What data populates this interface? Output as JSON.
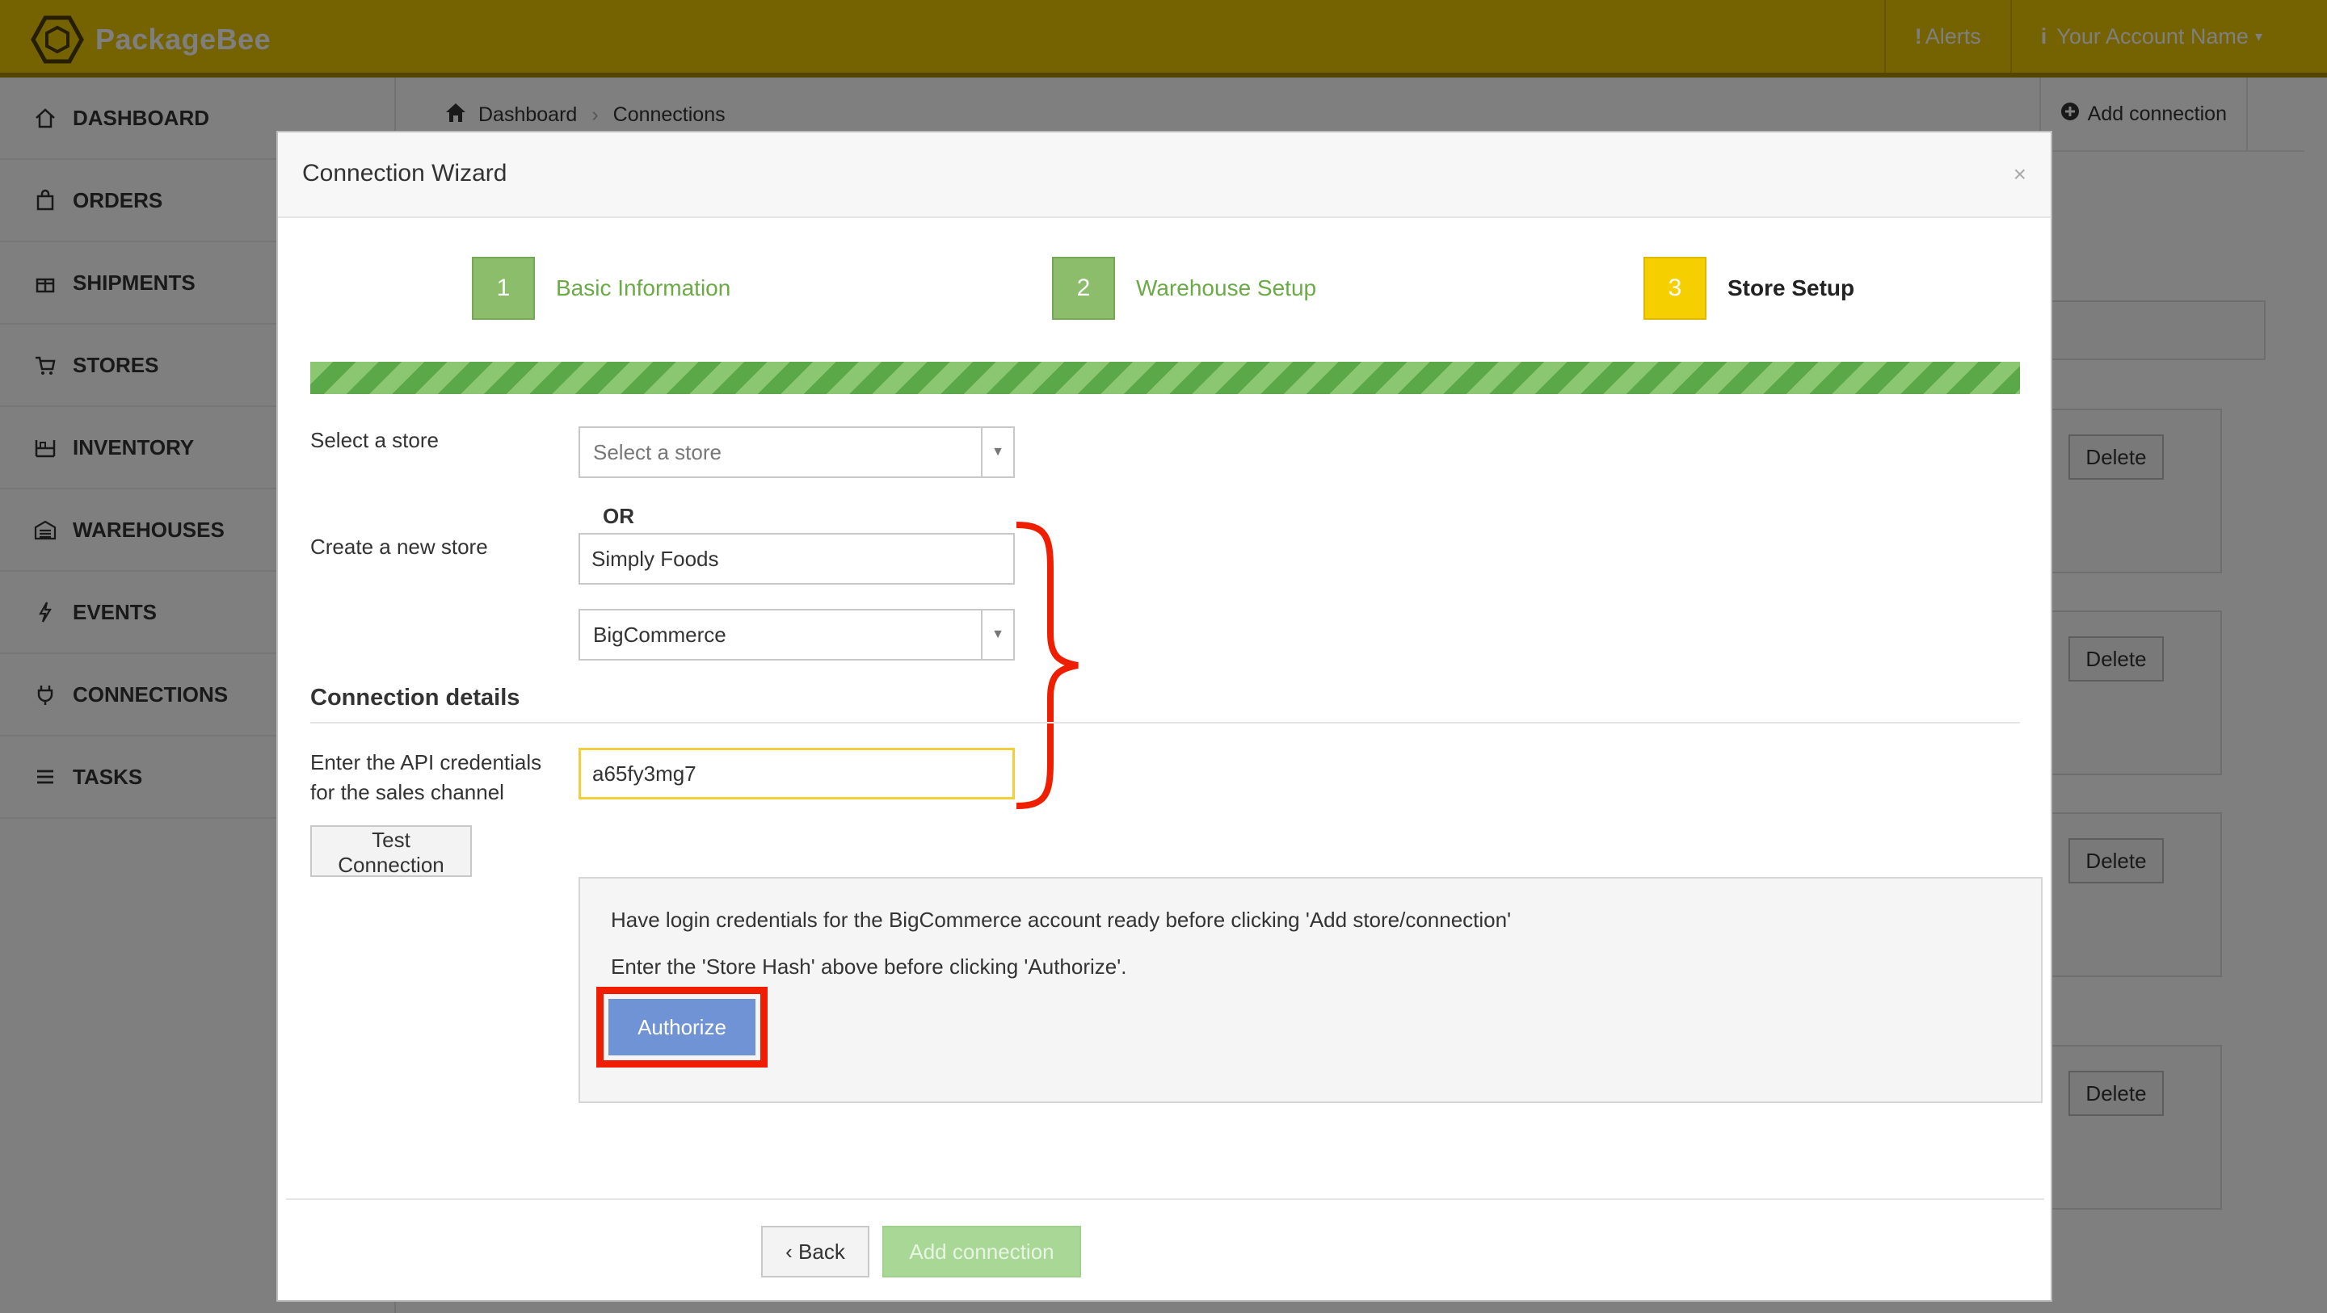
{
  "app": {
    "name": "PackageBee"
  },
  "topbar": {
    "alerts": "Alerts",
    "account": "Your Account Name"
  },
  "sidebar": {
    "items": [
      {
        "label": "DASHBOARD",
        "icon": "home-icon"
      },
      {
        "label": "ORDERS",
        "icon": "bag-icon"
      },
      {
        "label": "SHIPMENTS",
        "icon": "gift-icon"
      },
      {
        "label": "STORES",
        "icon": "cart-icon"
      },
      {
        "label": "INVENTORY",
        "icon": "inventory-icon"
      },
      {
        "label": "WAREHOUSES",
        "icon": "warehouse-icon"
      },
      {
        "label": "EVENTS",
        "icon": "bolt-icon"
      },
      {
        "label": "CONNECTIONS",
        "icon": "plug-icon"
      },
      {
        "label": "TASKS",
        "icon": "list-icon"
      }
    ]
  },
  "breadcrumb": {
    "home": "Dashboard",
    "current": "Connections",
    "add_connection": "Add connection"
  },
  "background": {
    "delete_label": "Delete"
  },
  "modal": {
    "title": "Connection Wizard",
    "close": "×",
    "steps": [
      {
        "number": "1",
        "label": "Basic Information",
        "state": "done"
      },
      {
        "number": "2",
        "label": "Warehouse Setup",
        "state": "done"
      },
      {
        "number": "3",
        "label": "Store Setup",
        "state": "active"
      }
    ],
    "select_store_label": "Select a store",
    "select_store_placeholder": "Select a store",
    "or_text": "OR",
    "create_store_label": "Create a new store",
    "new_store_name": "Simply Foods",
    "platform": "BigCommerce",
    "connection_details_title": "Connection details",
    "api_label_line1": "Enter the API credentials",
    "api_label_line2": "for the sales channel",
    "api_value": "a65fy3mg7",
    "test_button": "Test Connection",
    "info_line1": "Have login credentials for the BigCommerce account ready before clicking 'Add store/connection'",
    "info_line2": "Enter the 'Store Hash' above before clicking 'Authorize'.",
    "authorize_button": "Authorize",
    "back_button": "Back",
    "add_connection_button": "Add connection"
  },
  "colors": {
    "topbar": "#ebc500",
    "step_done": "#8bbd6b",
    "step_active": "#f5cf00",
    "progress_light": "#8bc670",
    "progress_dark": "#5aa848",
    "authorize": "#6f93d5",
    "annotation_red": "#f01e00"
  }
}
